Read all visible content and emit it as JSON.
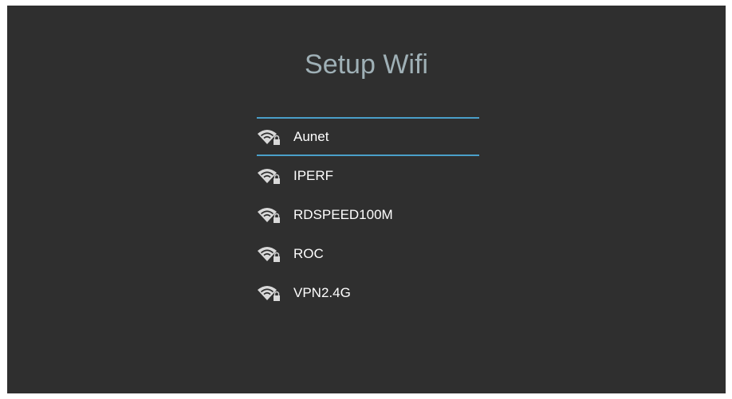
{
  "page": {
    "title": "Setup Wifi"
  },
  "wifi_networks": [
    {
      "name": "Aunet",
      "secured": true,
      "selected": true,
      "icon": "wifi-lock-icon"
    },
    {
      "name": "IPERF",
      "secured": true,
      "selected": false,
      "icon": "wifi-lock-icon"
    },
    {
      "name": "RDSPEED100M",
      "secured": true,
      "selected": false,
      "icon": "wifi-lock-icon"
    },
    {
      "name": "ROC",
      "secured": true,
      "selected": false,
      "icon": "wifi-lock-icon"
    },
    {
      "name": "VPN2.4G",
      "secured": true,
      "selected": false,
      "icon": "wifi-lock-icon"
    }
  ],
  "colors": {
    "background": "#2f2f2f",
    "title": "#9fb0b6",
    "selection_accent": "#4a9fc9",
    "item_text": "#ffffff"
  }
}
